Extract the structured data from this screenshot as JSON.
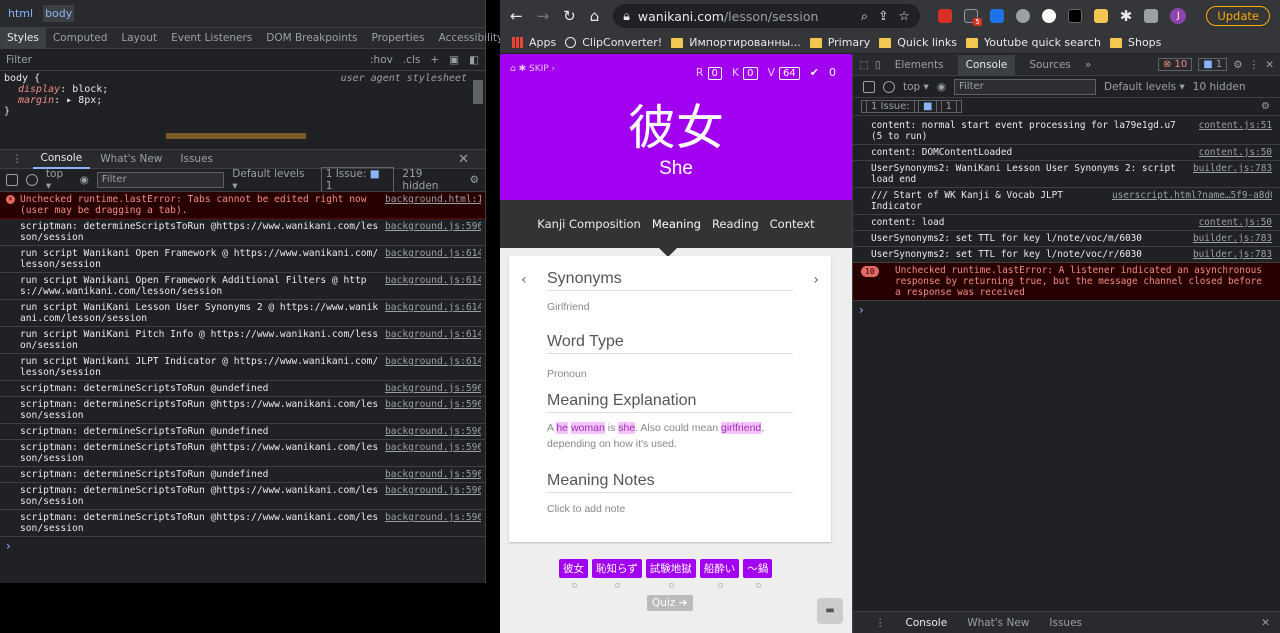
{
  "left_devtools": {
    "breadcrumbs": [
      "html",
      "body"
    ],
    "style_tabs": [
      "Styles",
      "Computed",
      "Layout",
      "Event Listeners",
      "DOM Breakpoints",
      "Properties",
      "Accessibility"
    ],
    "filter_placeholder": "Filter",
    "hov": ":hov",
    "cls": ".cls",
    "css_rule": {
      "selector": "body {",
      "source": "user agent stylesheet",
      "decls": [
        {
          "prop": "display",
          "value": "block;"
        },
        {
          "prop": "margin",
          "value": "8px;"
        }
      ],
      "close": "}"
    },
    "drawer_tabs": [
      "Console",
      "What's New",
      "Issues"
    ],
    "context": "top",
    "default_levels": "Default levels",
    "issue_label": "1 Issue:",
    "issue_count": "1",
    "hidden_count": "219 hidden",
    "logs": [
      {
        "type": "error",
        "msg": "Unchecked runtime.lastError: Tabs cannot be edited right now (user may be dragging a tab).",
        "src": "background.html:1"
      },
      {
        "type": "log",
        "msg": "scriptman: determineScriptsToRun @https://www.wanikani.com/lesson/session",
        "src": "background.js:596"
      },
      {
        "type": "log",
        "msg": "run script Wanikani Open Framework @ https://www.wanikani.com/lesson/session",
        "src": "background.js:614"
      },
      {
        "type": "log",
        "msg": "run script Wanikani Open Framework Additional Filters @ https://www.wanikani.com/lesson/session",
        "src": "background.js:614"
      },
      {
        "type": "log",
        "msg": "run script WaniKani Lesson User Synonyms 2 @ https://www.wanikani.com/lesson/session",
        "src": "background.js:614"
      },
      {
        "type": "log",
        "msg": "run script WaniKani Pitch Info @ https://www.wanikani.com/lesson/session",
        "src": "background.js:614"
      },
      {
        "type": "log",
        "msg": "run script Wanikani JLPT Indicator @ https://www.wanikani.com/lesson/session",
        "src": "background.js:614"
      },
      {
        "type": "log",
        "msg": "scriptman: determineScriptsToRun @undefined",
        "src": "background.js:596"
      },
      {
        "type": "log",
        "msg": "scriptman: determineScriptsToRun @https://www.wanikani.com/lesson/session",
        "src": "background.js:596"
      },
      {
        "type": "log",
        "msg": "scriptman: determineScriptsToRun @undefined",
        "src": "background.js:596"
      },
      {
        "type": "log",
        "msg": "scriptman: determineScriptsToRun @https://www.wanikani.com/lesson/session",
        "src": "background.js:596"
      },
      {
        "type": "log",
        "msg": "scriptman: determineScriptsToRun @undefined",
        "src": "background.js:596"
      },
      {
        "type": "log",
        "msg": "scriptman: determineScriptsToRun @https://www.wanikani.com/lesson/session",
        "src": "background.js:596"
      },
      {
        "type": "log",
        "msg": "scriptman: determineScriptsToRun @https://www.wanikani.com/lesson/session",
        "src": "background.js:596"
      }
    ]
  },
  "browser": {
    "url_host": "wanikani.com",
    "url_path": "/lesson/session",
    "update_label": "Update",
    "avatar_letter": "J",
    "ext_badge": "5",
    "bookmarks": [
      {
        "icon": "apps-grid-icon",
        "label": "Apps"
      },
      {
        "icon": "clipconverter-icon",
        "label": "ClipConverter!"
      },
      {
        "icon": "folder-icon",
        "label": "Импортированны..."
      },
      {
        "icon": "folder-icon",
        "label": "Primary"
      },
      {
        "icon": "folder-icon",
        "label": "Quick links"
      },
      {
        "icon": "folder-icon",
        "label": "Youtube quick search"
      },
      {
        "icon": "folder-icon",
        "label": "Shops"
      }
    ]
  },
  "wanikani": {
    "skip": "SKIP",
    "counts": {
      "r_label": "R",
      "r": "0",
      "k_label": "K",
      "k": "0",
      "v_label": "V",
      "v": "64",
      "done": "0"
    },
    "character": "彼女",
    "meaning": "She",
    "subnav": [
      "Kanji Composition",
      "Meaning",
      "Reading",
      "Context"
    ],
    "active_tab": "Meaning",
    "synonyms_title": "Synonyms",
    "synonyms": "Girlfriend",
    "word_type_title": "Word Type",
    "word_type": "Pronoun",
    "explanation_title": "Meaning Explanation",
    "explanation": {
      "p1": "A ",
      "hl1": "he",
      "p2": " ",
      "hl2": "woman",
      "p3": " is ",
      "hl3": "she",
      "p4": ". Also could mean ",
      "hl4": "girlfriend",
      "p5": ", depending on how it's used."
    },
    "notes_title": "Meaning Notes",
    "notes": "Click to add note",
    "items": [
      "彼女",
      "恥知らず",
      "試験地獄",
      "船酔い",
      "〜鍋"
    ],
    "quiz": "Quiz",
    "colors": {
      "accent": "#a100f1",
      "highlight_bg": "#f5c6fb"
    }
  },
  "right_devtools": {
    "tabs": [
      "Elements",
      "Console",
      "Sources"
    ],
    "active_tab": "Console",
    "error_count": "10",
    "issue_count": "1",
    "context": "top",
    "filter_placeholder": "Filter",
    "default_levels": "Default levels",
    "hidden_count": "10 hidden",
    "issue_label": "1 Issue:",
    "issue_num": "1",
    "logs": [
      {
        "type": "log",
        "msg": "content: normal start event processing for la79e1gd.u7 (5 to run)",
        "src": "content.js:51"
      },
      {
        "type": "log",
        "msg": "content: DOMContentLoaded",
        "src": "content.js:50"
      },
      {
        "type": "log",
        "msg": "UserSynonyms2: WaniKani Lesson User Synonyms 2: script load end",
        "src": "builder.js:783"
      },
      {
        "type": "log",
        "msg": "/// Start of WK Kanji & Vocab JLPT Indicator",
        "src": "userscript.html?name…5f9-a8d020c996ce:21"
      },
      {
        "type": "log",
        "msg": "content: load",
        "src": "content.js:50"
      },
      {
        "type": "log",
        "msg": "UserSynonyms2: set TTL for key  l/note/voc/m/6030",
        "src": "builder.js:783"
      },
      {
        "type": "log",
        "msg": "UserSynonyms2: set TTL for key  l/note/voc/r/6030",
        "src": "builder.js:783"
      },
      {
        "type": "error",
        "count": "10",
        "msg": "Unchecked runtime.lastError: A listener indicated an asynchronous response by returning true, but the message channel closed before a response was received",
        "src": ""
      }
    ],
    "drawer_tabs": [
      "Console",
      "What's New",
      "Issues"
    ]
  }
}
